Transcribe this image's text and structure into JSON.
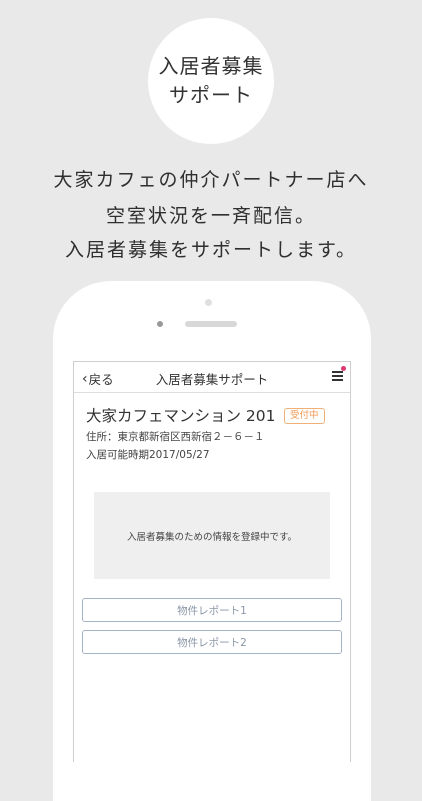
{
  "hero": {
    "badge_line1": "入居者募集",
    "badge_line2": "サポート",
    "tagline_line1": "大家カフェの仲介パートナー店へ",
    "tagline_line2": "空室状況を一斉配信。",
    "tagline_line3": "入居者募集をサポートします。"
  },
  "navbar": {
    "back_label": "戻る",
    "back_icon": "chevron-left-icon",
    "title": "入居者募集サポート",
    "menu_icon": "hamburger-menu-icon",
    "notification_color": "#e0376b"
  },
  "property": {
    "name": "大家カフェマンション 201",
    "status": "受付中",
    "status_color": "#ef9a55",
    "address": "住所：東京都新宿区西新宿２－６－１",
    "available_date": "入居可能時期2017/05/27"
  },
  "info_message": "入居者募集のための情報を登録中です。",
  "reports": [
    {
      "label": "物件レポート1"
    },
    {
      "label": "物件レポート2"
    }
  ]
}
